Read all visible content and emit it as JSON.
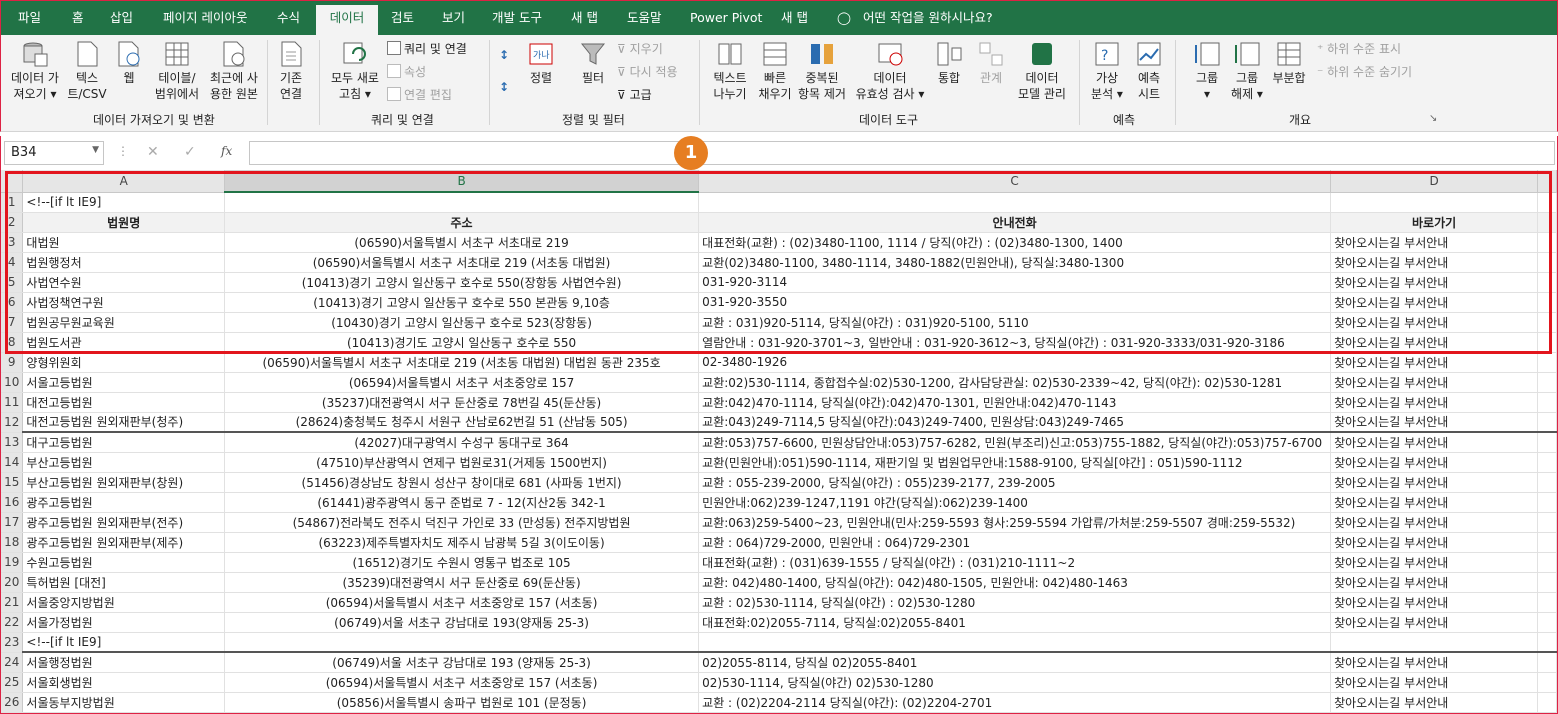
{
  "tabs": [
    "파일",
    "홈",
    "삽입",
    "페이지 레이아웃",
    "수식",
    "데이터",
    "검토",
    "보기",
    "개발 도구",
    "새 탭",
    "도움말",
    "Power Pivot",
    "새 탭"
  ],
  "tell_me": "어떤 작업을 원하시나요?",
  "ribbon": {
    "get_data": "데이터 가\n져오기 ▾",
    "text_csv": "텍스\n트/CSV",
    "web": "웹",
    "table_range": "테이블/\n범위에서",
    "recent_sources": "최근에 사\n용한 원본",
    "existing_conn": "기존\n연결",
    "group_get": "데이터 가져오기 및 변환",
    "refresh_all": "모두 새로\n고침 ▾",
    "queries_conn": "쿼리 및 연결",
    "properties": "속성",
    "edit_links": "연결 편집",
    "group_queries": "쿼리 및 연결",
    "sort": "정렬",
    "filter": "필터",
    "clear": "지우기",
    "reapply": "다시 적용",
    "advanced": "고급",
    "group_sort": "정렬 및 필터",
    "text_to_cols": "텍스트\n나누기",
    "flash_fill": "빠른\n채우기",
    "remove_dup": "중복된\n항목 제거",
    "validation": "데이터\n유효성 검사 ▾",
    "consolidate": "통합",
    "relations": "관계",
    "data_model": "데이터\n모델 관리",
    "group_tools": "데이터 도구",
    "whatif": "가상\n분석 ▾",
    "forecast": "예측\n시트",
    "group_forecast": "예측",
    "group_btn": "그룹\n▾",
    "ungroup": "그룹\n해제 ▾",
    "subtotal": "부분합",
    "show_detail": "하위 수준 표시",
    "hide_detail": "하위 수준 숨기기",
    "group_outline": "개요"
  },
  "name_box": "B34",
  "badge": "1",
  "columns": [
    "A",
    "B",
    "C",
    "D"
  ],
  "rows": [
    [
      "<!--[if lt IE9]",
      "",
      "",
      ""
    ],
    [
      "법원명",
      "주소",
      "안내전화",
      "바로가기"
    ],
    [
      "대법원",
      "(06590)서울특별시 서초구 서초대로 219",
      "대표전화(교환) : (02)3480-1100, 1114 / 당직(야간) : (02)3480-1300, 1400",
      "찾아오시는길 부서안내"
    ],
    [
      "법원행정처",
      "(06590)서울특별시 서초구 서초대로 219 (서초동 대법원)",
      "교환(02)3480-1100, 3480-1114, 3480-1882(민원안내), 당직실:3480-1300",
      "찾아오시는길 부서안내"
    ],
    [
      "사법연수원",
      "(10413)경기 고양시 일산동구 호수로 550(장항동 사법연수원)",
      "031-920-3114",
      "찾아오시는길 부서안내"
    ],
    [
      "사법정책연구원",
      "(10413)경기 고양시 일산동구 호수로 550 본관동 9,10층",
      "031-920-3550",
      "찾아오시는길 부서안내"
    ],
    [
      "법원공무원교육원",
      "(10430)경기 고양시 일산동구 호수로 523(장항동)",
      "교환 : 031)920-5114, 당직실(야간) : 031)920-5100, 5110",
      "찾아오시는길 부서안내"
    ],
    [
      "법원도서관",
      "(10413)경기도 고양시 일산동구 호수로 550",
      "열람안내 : 031-920-3701~3, 일반안내 : 031-920-3612~3, 당직실(야간) : 031-920-3333/031-920-3186",
      "찾아오시는길 부서안내"
    ],
    [
      "양형위원회",
      "(06590)서울특별시 서초구 서초대로 219 (서초동 대법원) 대법원 동관 235호",
      "02-3480-1926",
      "찾아오시는길 부서안내"
    ],
    [
      "서울고등법원",
      "(06594)서울특별시 서초구 서초중앙로 157",
      "교환:02)530-1114, 종합접수실:02)530-1200, 감사담당관실: 02)530-2339~42, 당직(야간): 02)530-1281",
      "찾아오시는길 부서안내"
    ],
    [
      "대전고등법원",
      "(35237)대전광역시 서구 둔산중로 78번길 45(둔산동)",
      "교환:042)470-1114, 당직실(야간):042)470-1301, 민원안내:042)470-1143",
      "찾아오시는길 부서안내"
    ],
    [
      "대전고등법원 원외재판부(청주)",
      "(28624)충청북도 청주시 서원구 산남로62번길 51 (산남동 505)",
      "교환:043)249-7114,5 당직실(야간):043)249-7400, 민원상담:043)249-7465",
      "찾아오시는길 부서안내"
    ],
    [
      "대구고등법원",
      "(42027)대구광역시 수성구 동대구로 364",
      "교환:053)757-6600, 민원상담안내:053)757-6282, 민원(부조리)신고:053)755-1882, 당직실(야간):053)757-6700",
      "찾아오시는길 부서안내"
    ],
    [
      "부산고등법원",
      "(47510)부산광역시 연제구 법원로31(거제동 1500번지)",
      "교환(민원안내):051)590-1114, 재판기일 및 법원업무안내:1588-9100, 당직실[야간] : 051)590-1112",
      "찾아오시는길 부서안내"
    ],
    [
      "부산고등법원 원외재판부(창원)",
      "(51456)경상남도 창원시 성산구 창이대로 681 (사파동 1번지)",
      "교환 : 055-239-2000, 당직실(야간) : 055)239-2177, 239-2005",
      "찾아오시는길 부서안내"
    ],
    [
      "광주고등법원",
      "(61441)광주광역시 동구 준법로 7 - 12(지산2동 342-1",
      "민원안내:062)239-1247,1191 야간(당직실):062)239-1400",
      "찾아오시는길 부서안내"
    ],
    [
      "광주고등법원 원외재판부(전주)",
      "(54867)전라북도 전주시 덕진구 가인로 33 (만성동) 전주지방법원",
      "교환:063)259-5400~23, 민원안내(민사:259-5593 형사:259-5594 가압류/가처분:259-5507 경매:259-5532)",
      "찾아오시는길 부서안내"
    ],
    [
      "광주고등법원 원외재판부(제주)",
      "(63223)제주특별자치도 제주시 남광북 5길 3(이도이동)",
      "교환 : 064)729-2000, 민원안내 : 064)729-2301",
      "찾아오시는길 부서안내"
    ],
    [
      "수원고등법원",
      "(16512)경기도 수원시 영통구 법조로 105",
      "대표전화(교환) : (031)639-1555 / 당직실(야간) : (031)210-1111~2",
      "찾아오시는길 부서안내"
    ],
    [
      "특허법원 [대전]",
      "(35239)대전광역시 서구 둔산중로 69(둔산동)",
      "교환: 042)480-1400, 당직실(야간): 042)480-1505, 민원안내: 042)480-1463",
      "찾아오시는길 부서안내"
    ],
    [
      "서울중앙지방법원",
      "(06594)서울특별시 서초구 서초중앙로 157 (서초동)",
      "교환 : 02)530-1114, 당직실(야간) : 02)530-1280",
      "찾아오시는길 부서안내"
    ],
    [
      "서울가정법원",
      "(06749)서울 서초구 강남대로 193(양재동 25-3)",
      "대표전화:02)2055-7114, 당직실:02)2055-8401",
      "찾아오시는길 부서안내"
    ],
    [
      "<!--[if lt IE9]",
      "",
      "",
      ""
    ],
    [
      "서울행정법원",
      "(06749)서울 서초구 강남대로 193 (양재동 25-3)",
      "02)2055-8114, 당직실 02)2055-8401",
      "찾아오시는길 부서안내"
    ],
    [
      "서울회생법원",
      "(06594)서울특별시 서초구 서초중앙로 157 (서초동)",
      "02)530-1114, 당직실(야간) 02)530-1280",
      "찾아오시는길 부서안내"
    ],
    [
      "서울동부지방법원",
      "(05856)서울특별시 송파구 법원로 101 (문정동)",
      "교환 : (02)2204-2114 당직실(야간): (02)2204-2701",
      "찾아오시는길 부서안내"
    ]
  ]
}
